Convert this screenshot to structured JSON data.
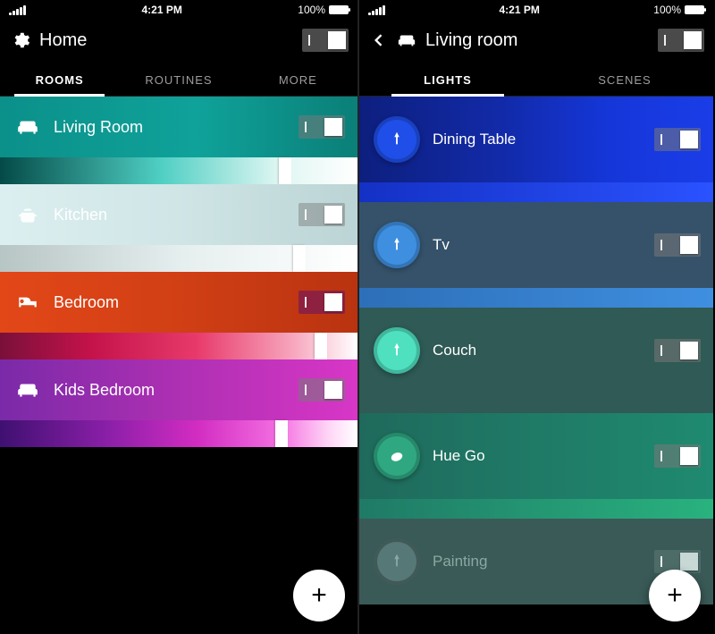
{
  "status": {
    "time": "4:21 PM",
    "battery_pct": "100%"
  },
  "left": {
    "title": "Home",
    "tabs": [
      "ROOMS",
      "ROUTINES",
      "MORE"
    ],
    "active_tab": 0,
    "rooms": [
      {
        "name": "Living Room",
        "icon": "sofa",
        "gradient": "teal",
        "brightness": 0.78,
        "on": true
      },
      {
        "name": "Kitchen",
        "icon": "pot",
        "gradient": "pale",
        "brightness": 0.82,
        "on": true
      },
      {
        "name": "Bedroom",
        "icon": "bed",
        "gradient": "orange",
        "brightness": 0.88,
        "on": true
      },
      {
        "name": "Kids Bedroom",
        "icon": "sofa",
        "gradient": "magenta",
        "brightness": 0.77,
        "on": true
      }
    ],
    "fab": "+"
  },
  "right": {
    "title": "Living room",
    "tabs": [
      "LIGHTS",
      "SCENES"
    ],
    "active_tab": 0,
    "lights": [
      {
        "name": "Dining Table",
        "icon": "bulb",
        "color": "#1f4fe8",
        "row": "lr1",
        "on": true
      },
      {
        "name": "Tv",
        "icon": "bulb",
        "color": "#3f8fe0",
        "row": "lr2",
        "on": true
      },
      {
        "name": "Couch",
        "icon": "bulb",
        "color": "#4fe0c0",
        "row": "lr3",
        "on": true
      },
      {
        "name": "Hue Go",
        "icon": "go",
        "color": "#2fa882",
        "row": "lr4",
        "on": true
      },
      {
        "name": "Painting",
        "icon": "bulb",
        "color": "#567876",
        "row": "lr5",
        "on": false
      }
    ],
    "fab": "+"
  }
}
